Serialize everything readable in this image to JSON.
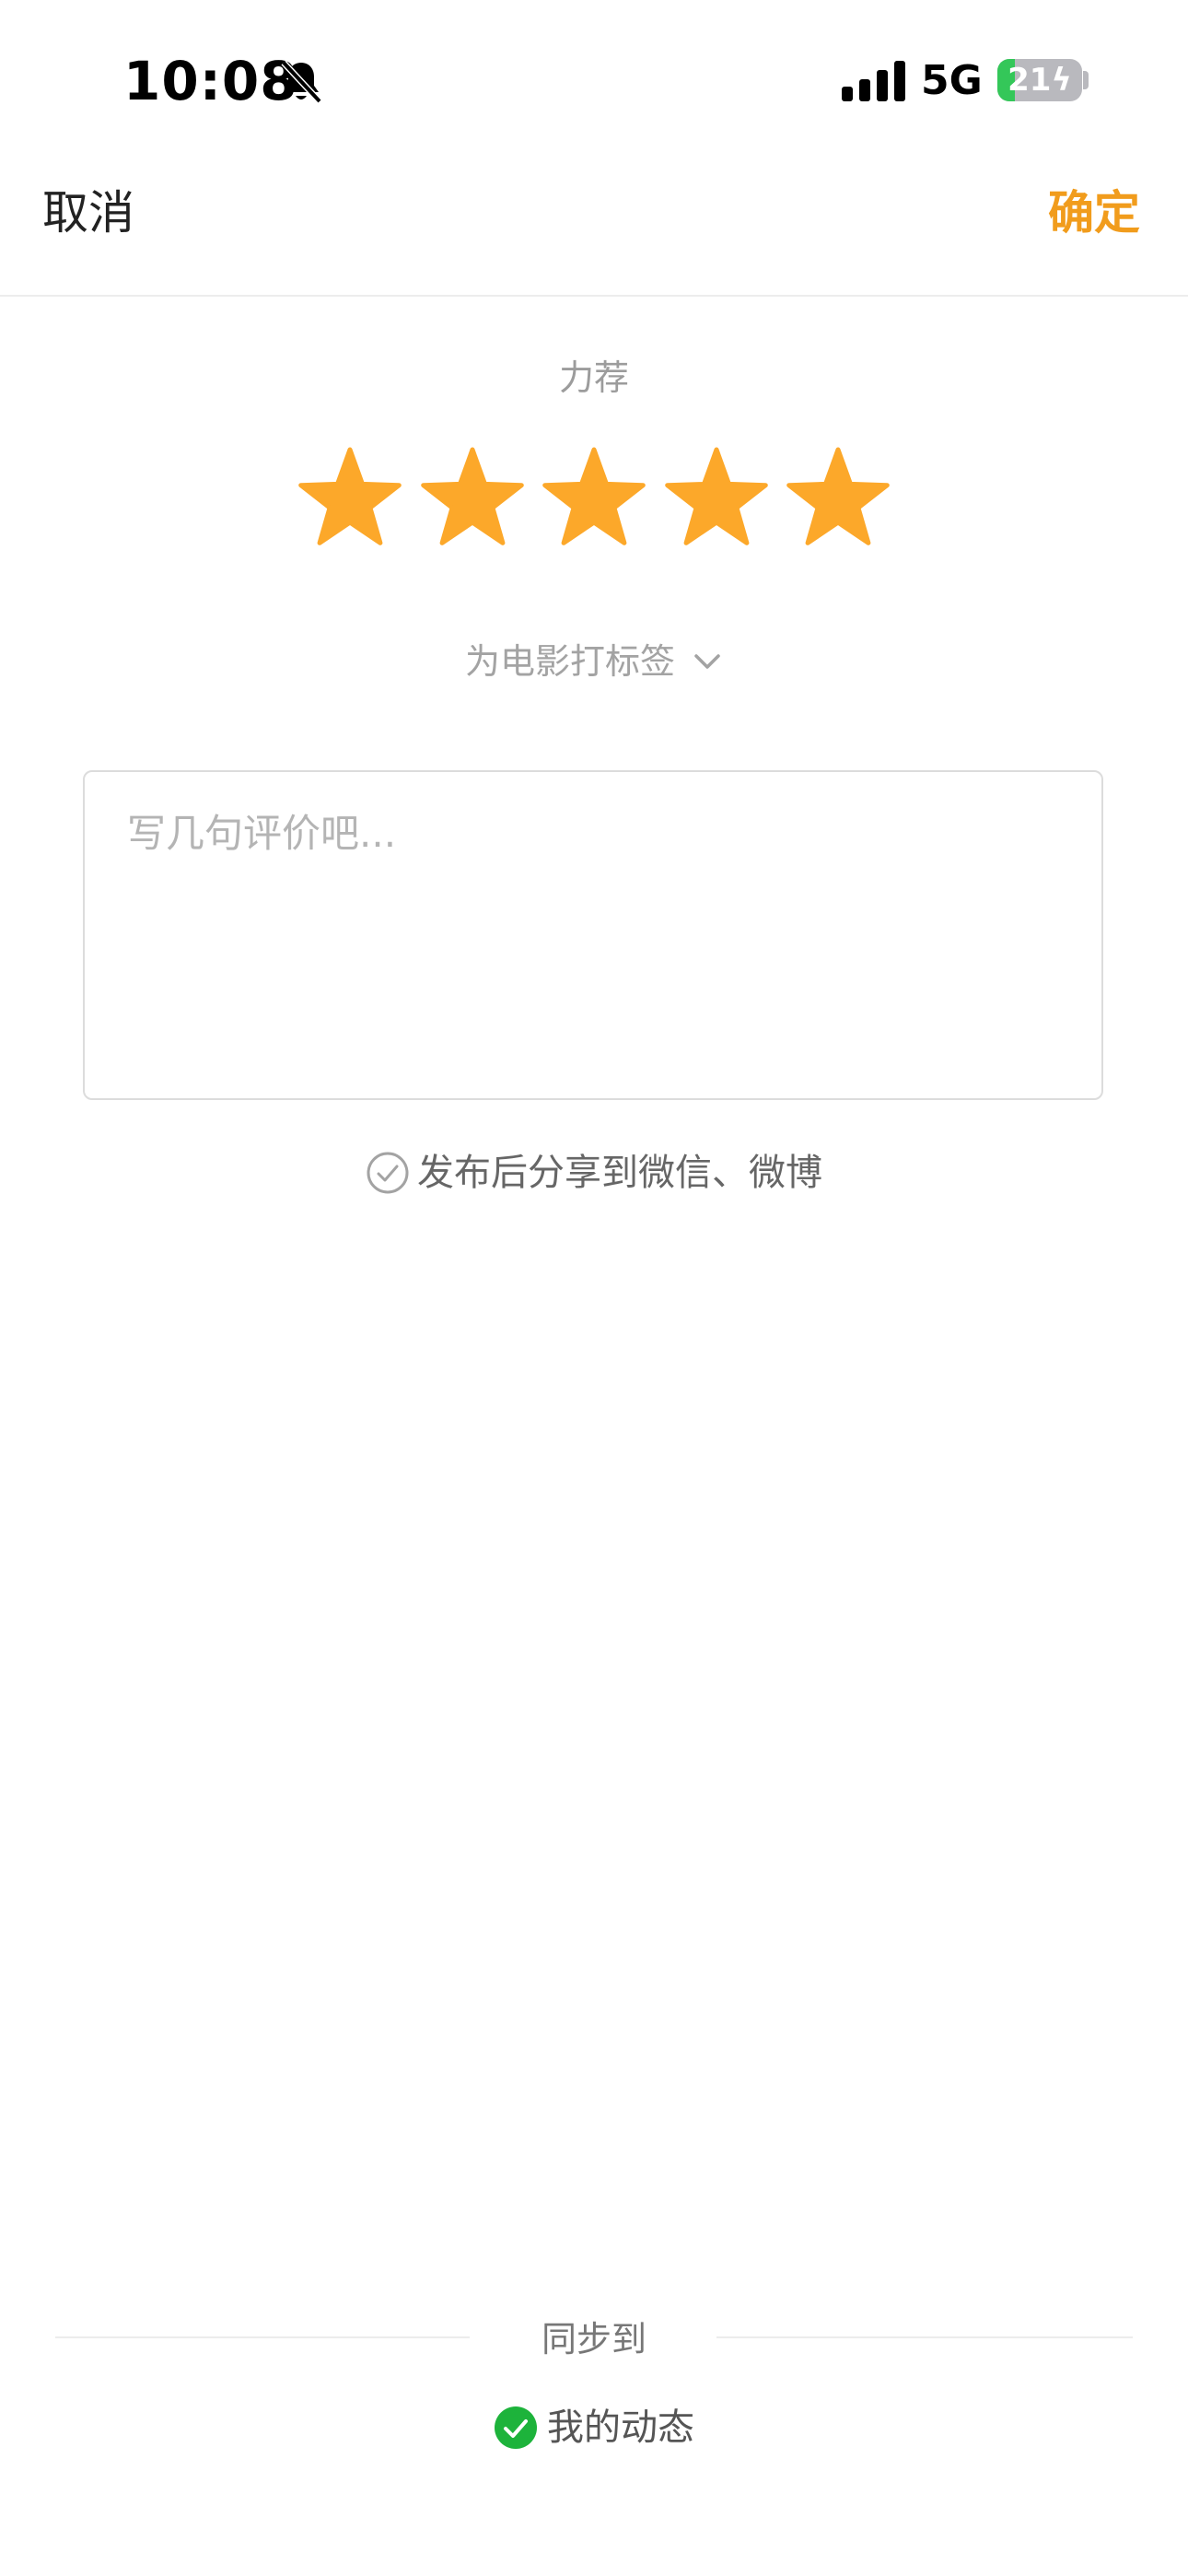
{
  "status_bar": {
    "time": "10:08",
    "mute_icon": "bell-slash-icon",
    "network": "5G",
    "battery_level": "21",
    "battery_fraction": 0.21,
    "battery_charging": true
  },
  "nav": {
    "cancel_label": "取消",
    "confirm_label": "确定",
    "confirm_color": "#f19c1c"
  },
  "rating": {
    "label": "力荐",
    "stars_filled": 5,
    "stars_total": 5,
    "star_color": "#fca82a"
  },
  "tag": {
    "label": "为电影打标签",
    "icon": "chevron-down-icon"
  },
  "review": {
    "placeholder": "写几句评价吧...",
    "value": ""
  },
  "share": {
    "label": "发布后分享到微信、微博",
    "checked": false
  },
  "sync": {
    "title": "同步到",
    "moment_label": "我的动态",
    "moment_checked": true,
    "check_color": "#1db33b"
  }
}
